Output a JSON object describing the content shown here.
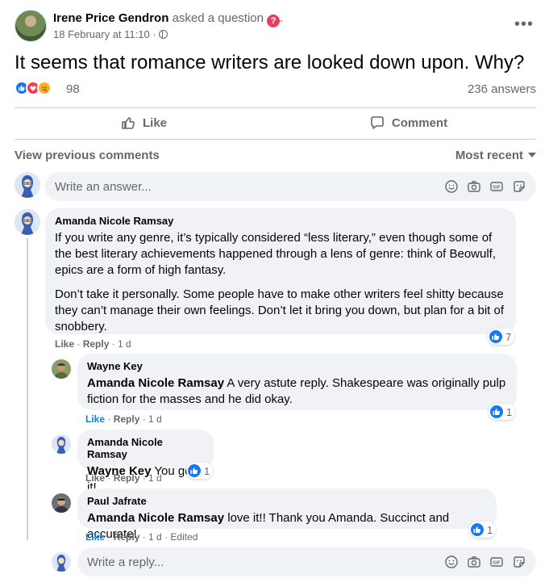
{
  "post": {
    "author": "Irene Price Gendron",
    "action": "asked a question",
    "after_action": ".",
    "date": "18 February at 11:10",
    "dot": "·",
    "question": "It seems that romance writers are looked down upon. Why?",
    "reaction_count": "98",
    "answers_count": "236 answers",
    "like_label": "Like",
    "comment_label": "Comment",
    "more_label": "•••"
  },
  "comments_header": {
    "view_previous": "View previous comments",
    "sort": "Most recent"
  },
  "answer_input": {
    "placeholder": "Write an answer..."
  },
  "comments": [
    {
      "author": "Amanda Nicole Ramsay",
      "paragraphs": [
        "If you write any genre, it’s typically considered “less literary,” even though some of the best literary achievements happened through a lens of genre: think of Beowulf, epics are a form of high fantasy.",
        "Don’t take it personally. Some people have to make other writers feel shitty because they can’t manage their own feelings. Don’t let it bring you down, but plan for a bit of snobbery."
      ],
      "like": "Like",
      "reply": "Reply",
      "time": "1 d",
      "likes": "7"
    }
  ],
  "replies": [
    {
      "author": "Wayne Key",
      "tag": "Amanda Nicole Ramsay",
      "text": " A very astute reply. Shakespeare was originally pulp fiction for the masses and he did okay.",
      "like": "Like",
      "reply": "Reply",
      "time": "1 d",
      "likes": "1"
    },
    {
      "author": "Amanda Nicole Ramsay",
      "tag": "Wayne Key",
      "text": " You got it!",
      "like": "Like",
      "reply": "Reply",
      "time": "1 d",
      "likes": "1"
    },
    {
      "author": "Paul Jafrate",
      "tag": "Amanda Nicole Ramsay",
      "text": " love it!! Thank you Amanda. Succinct and accurate!",
      "like": "Like",
      "reply": "Reply",
      "time": "1 d",
      "edited": "Edited",
      "likes": "1"
    }
  ],
  "reply_input": {
    "placeholder": "Write a reply..."
  },
  "sep": " · ",
  "colors": {
    "accent": "#1877f2",
    "muted": "#65676b",
    "bubble": "#f0f2f5"
  }
}
